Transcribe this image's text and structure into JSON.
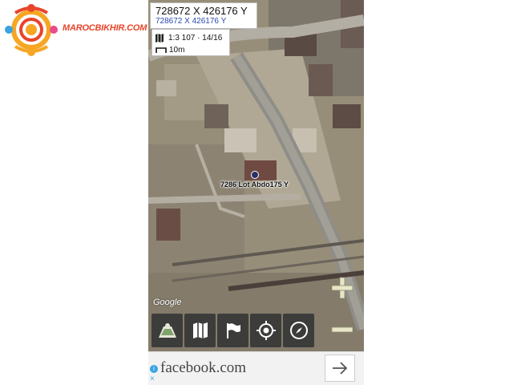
{
  "logo": {
    "text": "MAROCBIKHIR.COM",
    "colors": [
      "#e8442a",
      "#f6a623",
      "#3aa3e3",
      "#e84a8a"
    ]
  },
  "map": {
    "coords_primary": "728672 X  426176 Y",
    "coords_secondary": "728672 X  426176 Y",
    "scale_zoom": "1:3 107 · 14/16",
    "scale_distance": "10m",
    "marker_label": "7286 Lot Abdo175 Y",
    "provider": "Google",
    "zoom_in_icon": "plus-icon",
    "zoom_out_icon": "minus-icon"
  },
  "toolbar": {
    "buttons": [
      {
        "name": "layers-button",
        "icon": "map-layers-icon"
      },
      {
        "name": "map-button",
        "icon": "map-icon"
      },
      {
        "name": "flag-button",
        "icon": "flag-icon"
      },
      {
        "name": "locate-button",
        "icon": "crosshair-icon"
      },
      {
        "name": "compass-button",
        "icon": "compass-icon"
      }
    ]
  },
  "ad": {
    "text": "facebook.com",
    "info": "i",
    "close": "×",
    "arrow_icon": "arrow-right-icon"
  }
}
